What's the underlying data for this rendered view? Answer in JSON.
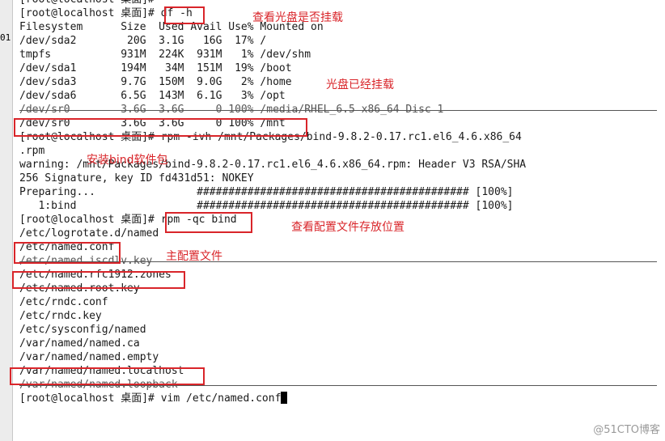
{
  "gutter": {
    "text": "01"
  },
  "terminal": {
    "lines": [
      "[root@localhost 桌面]#",
      "[root@localhost 桌面]# df -h",
      "Filesystem      Size  Used Avail Use% Mounted on",
      "/dev/sda2        20G  3.1G   16G  17% /",
      "tmpfs           931M  224K  931M   1% /dev/shm",
      "/dev/sda1       194M   34M  151M  19% /boot",
      "/dev/sda3       9.7G  150M  9.0G   2% /home",
      "/dev/sda6       6.5G  143M  6.1G   3% /opt",
      "/dev/sr0        3.6G  3.6G     0 100% /media/RHEL_6.5 x86_64 Disc 1",
      "/dev/sr0        3.6G  3.6G     0 100% /mnt",
      "[root@localhost 桌面]# rpm -ivh /mnt/Packages/bind-9.8.2-0.17.rc1.el6_4.6.x86_64",
      ".rpm",
      "warning: /mnt/Packages/bind-9.8.2-0.17.rc1.el6_4.6.x86_64.rpm: Header V3 RSA/SHA",
      "256 Signature, key ID fd431d51: NOKEY",
      "Preparing...                ########################################### [100%]",
      "   1:bind                   ########################################### [100%]",
      "[root@localhost 桌面]# rpm -qc bind",
      "/etc/logrotate.d/named",
      "/etc/named.conf",
      "/etc/named.iscdlv.key",
      "/etc/named.rfc1912.zones",
      "/etc/named.root.key",
      "/etc/rndc.conf",
      "/etc/rndc.key",
      "/etc/sysconfig/named",
      "/var/named/named.ca",
      "/var/named/named.empty",
      "/var/named/named.localhost",
      "/var/named/named.loopback",
      "[root@localhost 桌面]# vim /etc/named.conf"
    ]
  },
  "annotations": {
    "check_mount": "查看光盘是否挂载",
    "mounted": "光盘已经挂载",
    "install_bind": "安装bind软件包",
    "check_config": "查看配置文件存放位置",
    "main_config": "主配置文件"
  },
  "watermark": "@51CTO博客",
  "colors": {
    "annotation": "#d9252a",
    "background": "#ffffff",
    "text": "#1a1a1a"
  }
}
